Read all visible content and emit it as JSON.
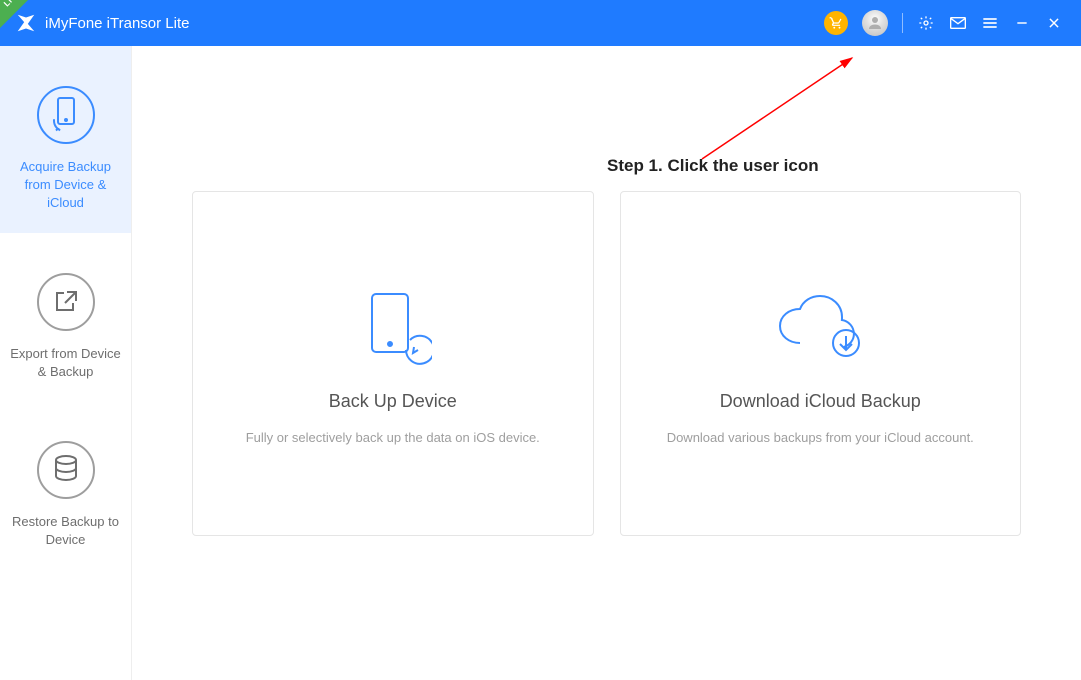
{
  "ribbon": {
    "label": "LITE"
  },
  "app": {
    "title": "iMyFone iTransor Lite"
  },
  "instruction": "Step 1. Click the user icon",
  "sidebar": {
    "items": [
      {
        "label": "Acquire Backup from Device & iCloud"
      },
      {
        "label": "Export from Device & Backup"
      },
      {
        "label": "Restore Backup to Device"
      }
    ]
  },
  "cards": [
    {
      "title": "Back Up Device",
      "sub": "Fully or selectively back up the data on iOS device."
    },
    {
      "title": "Download iCloud Backup",
      "sub": "Download various backups from your iCloud account."
    }
  ]
}
